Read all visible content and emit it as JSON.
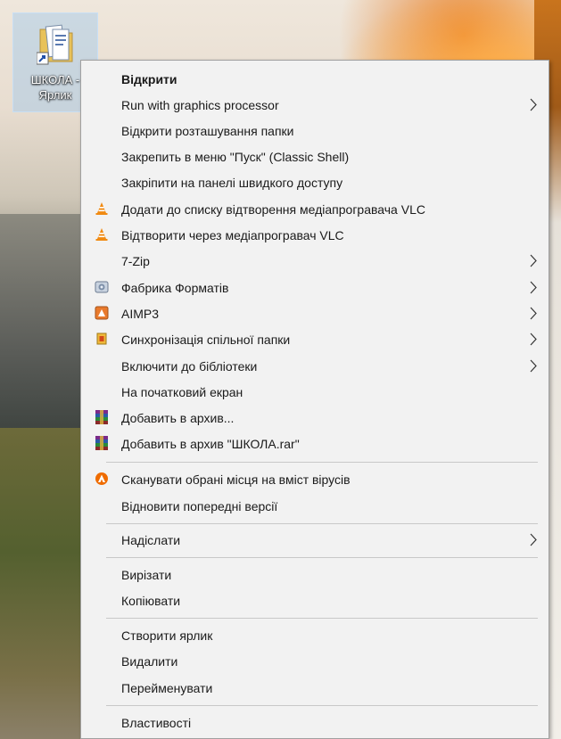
{
  "desktop": {
    "icon_label_line1": "ШКОЛА -",
    "icon_label_line2": "Ярлик"
  },
  "menu": {
    "items": [
      {
        "label": "Відкрити",
        "bold": true,
        "icon": "",
        "submenu": false
      },
      {
        "label": "Run with graphics processor",
        "icon": "",
        "submenu": true
      },
      {
        "label": "Відкрити розташування папки",
        "icon": "",
        "submenu": false
      },
      {
        "label": "Закрепить в меню \"Пуск\" (Classic Shell)",
        "icon": "",
        "submenu": false
      },
      {
        "label": "Закріпити на панелі швидкого доступу",
        "icon": "",
        "submenu": false
      },
      {
        "label": "Додати до списку відтворення медіапрогравача VLC",
        "icon": "vlc-cone-icon",
        "submenu": false
      },
      {
        "label": "Відтворити через медіапрогравач VLC",
        "icon": "vlc-cone-icon",
        "submenu": false
      },
      {
        "label": "7-Zip",
        "icon": "",
        "submenu": true
      },
      {
        "label": "Фабрика Форматів",
        "icon": "format-factory-icon",
        "submenu": true
      },
      {
        "label": "AIMP3",
        "icon": "aimp-icon",
        "submenu": true
      },
      {
        "label": "Синхронізація спільної папки",
        "icon": "sync-folder-icon",
        "submenu": true
      },
      {
        "label": "Включити до бібліотеки",
        "icon": "",
        "submenu": true
      },
      {
        "label": "На початковий екран",
        "icon": "",
        "submenu": false
      },
      {
        "label": "Добавить в архив...",
        "icon": "winrar-icon",
        "submenu": false
      },
      {
        "label": "Добавить в архив \"ШКОЛА.rar\"",
        "icon": "winrar-icon",
        "submenu": false
      },
      {
        "label": "Сканувати обрані місця на вміст вірусів",
        "icon": "avast-icon",
        "submenu": false
      },
      {
        "label": "Відновити попередні версії",
        "icon": "",
        "submenu": false
      },
      {
        "label": "Надіслати",
        "icon": "",
        "submenu": true
      },
      {
        "label": "Вирізати",
        "icon": "",
        "submenu": false
      },
      {
        "label": "Копіювати",
        "icon": "",
        "submenu": false
      },
      {
        "label": "Створити ярлик",
        "icon": "",
        "submenu": false
      },
      {
        "label": "Видалити",
        "icon": "",
        "submenu": false
      },
      {
        "label": "Перейменувати",
        "icon": "",
        "submenu": false
      },
      {
        "label": "Властивості",
        "icon": "",
        "submenu": false
      }
    ]
  },
  "colors": {
    "menu_bg": "#f2f2f2",
    "separator": "#c8c8c8",
    "vlc_orange": "#f08a12",
    "avast_orange": "#ef6c00"
  }
}
